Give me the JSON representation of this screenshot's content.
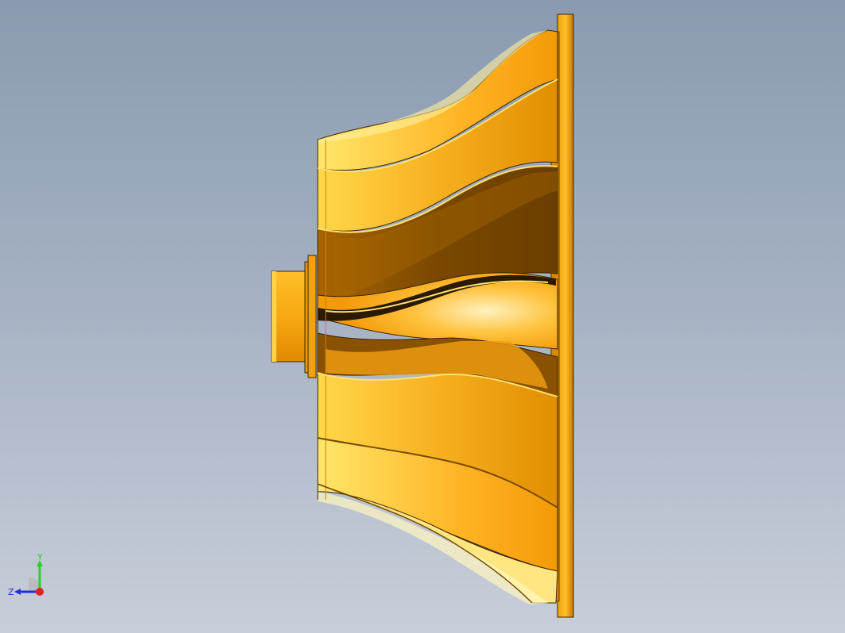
{
  "viewport": {
    "background_top": "#8a9ab0",
    "background_bottom": "#c8ced9"
  },
  "model": {
    "name": "horn-speaker",
    "color_light": "#ffd23a",
    "color_mid": "#f4a10d",
    "color_dark": "#7a4a00",
    "edge_color": "#3a2600"
  },
  "triad": {
    "y_label": "Y",
    "z_label": "Z",
    "y_color": "#2bd02b",
    "z_color": "#2030e0",
    "x_color": "#e02020"
  }
}
